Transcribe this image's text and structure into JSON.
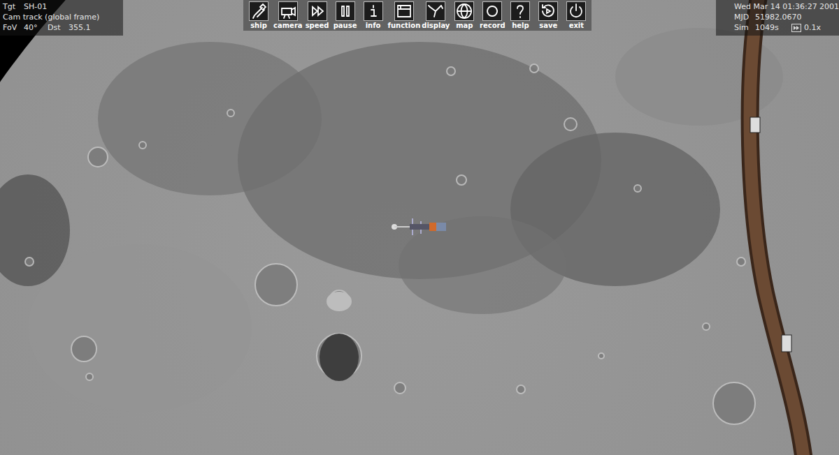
{
  "hud_left": {
    "target_label": "Tgt",
    "target": "SH-01",
    "camera_mode": "Cam track (global frame)",
    "fov_label": "FoV",
    "fov": "40°",
    "dst_label": "Dst",
    "dst": "355.1"
  },
  "toolbar": [
    {
      "label": "ship"
    },
    {
      "label": "camera"
    },
    {
      "label": "speed"
    },
    {
      "label": "pause"
    },
    {
      "label": "info"
    },
    {
      "label": "function"
    },
    {
      "label": "display"
    },
    {
      "label": "map"
    },
    {
      "label": "record"
    },
    {
      "label": "help"
    },
    {
      "label": "save"
    },
    {
      "label": "exit"
    }
  ],
  "hud_right": {
    "date": "Wed Mar 14 01:36:27 2001",
    "mjd_label": "MJD",
    "mjd": "51982.0670",
    "sim_label": "Sim",
    "sim": "1049s",
    "warp": "0.1x"
  }
}
